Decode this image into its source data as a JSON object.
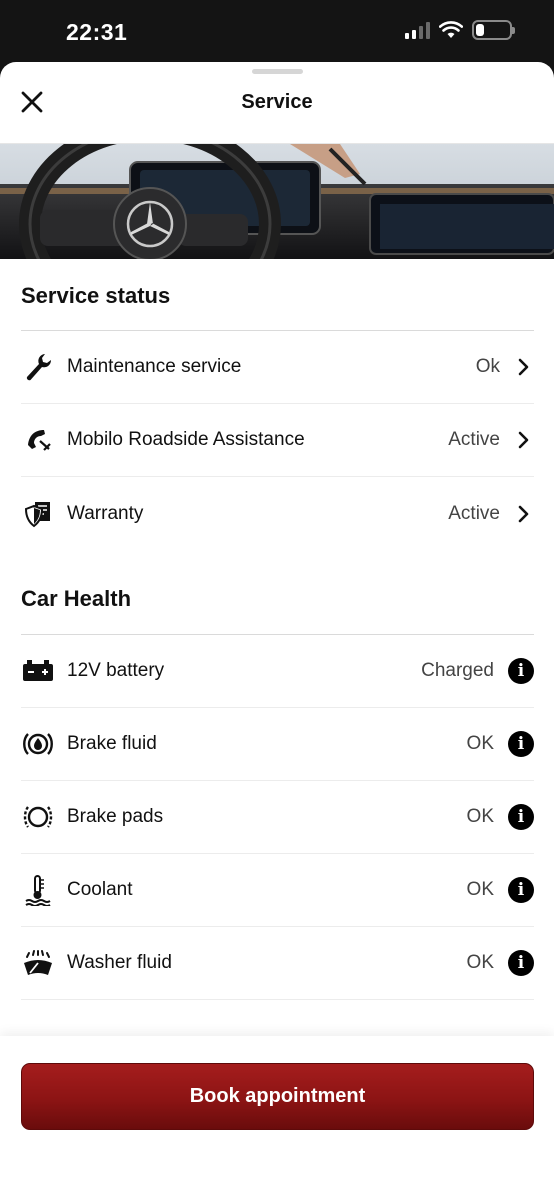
{
  "status_bar": {
    "time": "22:31"
  },
  "header": {
    "title": "Service"
  },
  "service_status": {
    "title": "Service status",
    "items": [
      {
        "icon": "wrench-icon",
        "label": "Maintenance service",
        "value": "Ok"
      },
      {
        "icon": "roadside-phone-icon",
        "label": "Mobilo Roadside Assistance",
        "value": "Active"
      },
      {
        "icon": "warranty-shield-icon",
        "label": "Warranty",
        "value": "Active"
      }
    ]
  },
  "car_health": {
    "title": "Car Health",
    "items": [
      {
        "icon": "battery-icon",
        "label": "12V battery",
        "value": "Charged"
      },
      {
        "icon": "brake-fluid-icon",
        "label": "Brake fluid",
        "value": "OK"
      },
      {
        "icon": "brake-pads-icon",
        "label": "Brake pads",
        "value": "OK"
      },
      {
        "icon": "coolant-icon",
        "label": "Coolant",
        "value": "OK"
      },
      {
        "icon": "washer-fluid-icon",
        "label": "Washer fluid",
        "value": "OK"
      }
    ]
  },
  "footer": {
    "book_label": "Book appointment"
  },
  "colors": {
    "accent": "#8c1414",
    "text": "#111111"
  }
}
